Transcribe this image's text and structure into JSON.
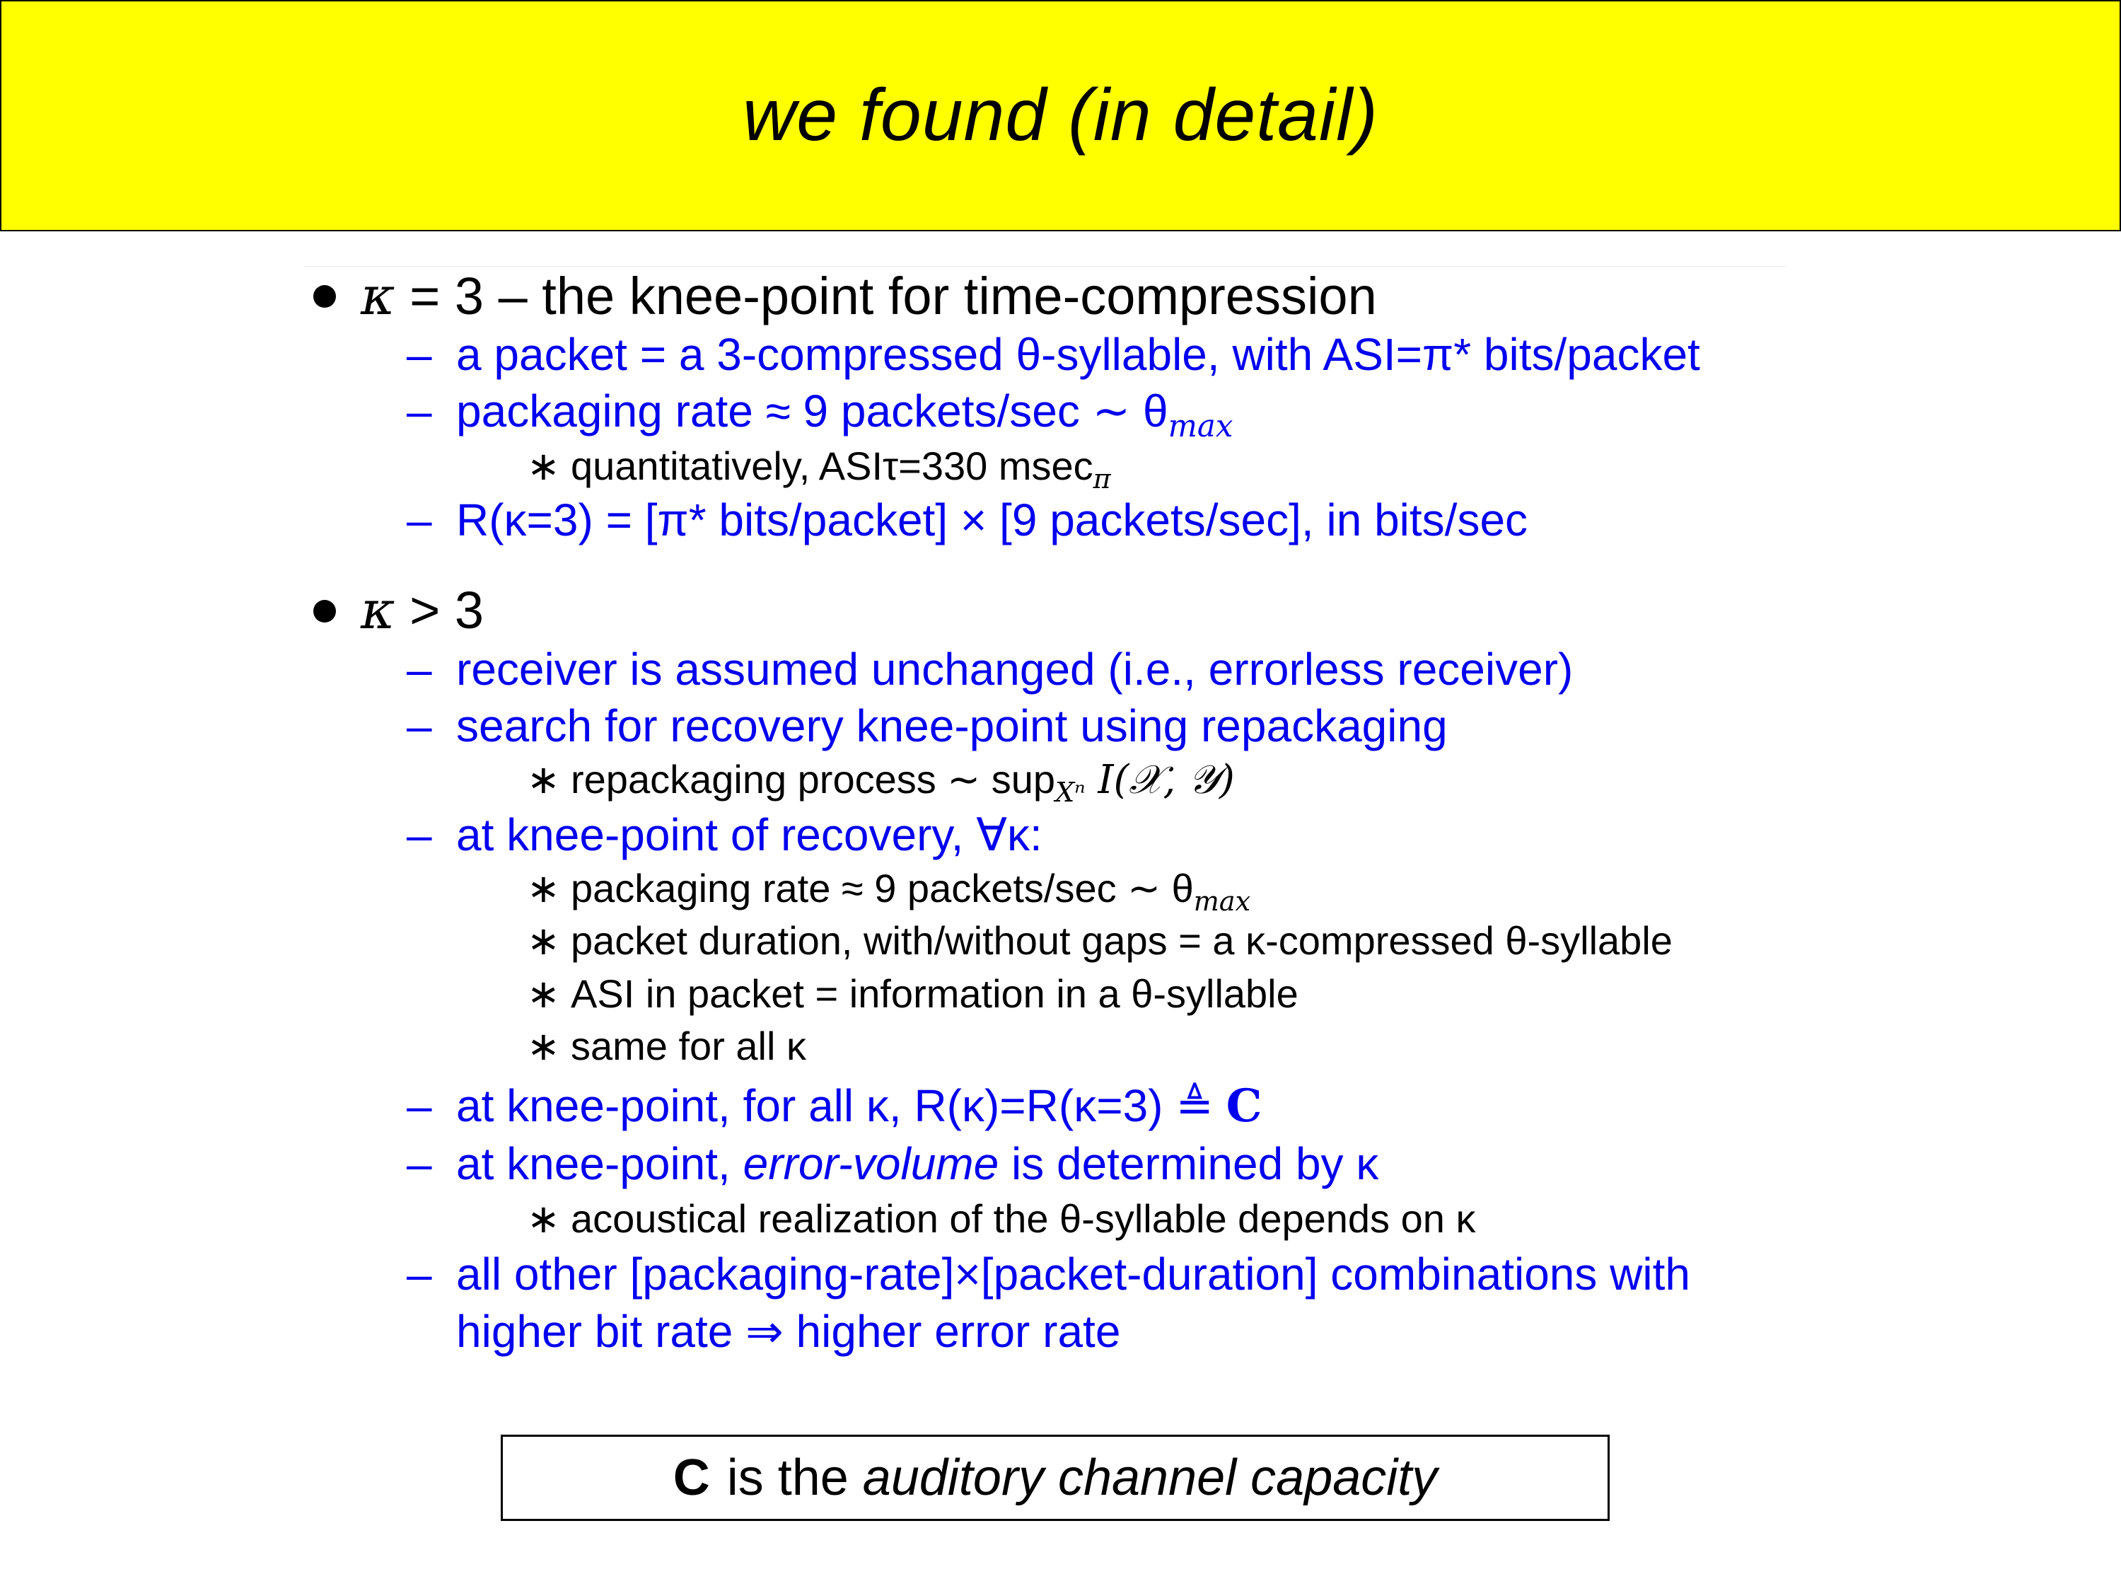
{
  "title": "we found (in detail)",
  "section1": {
    "heading_kappa": "κ",
    "heading_eq": " = 3 – the knee-point for time-compression",
    "items": [
      "a packet = a 3-compressed θ-syllable, with ASI=π* bits/packet",
      "packaging rate ≈ 9 packets/sec ∼ θ",
      "quantitatively, ASIτ=330 msec",
      "R(κ=3) = [π* bits/packet] × [9 packets/sec], in bits/sec"
    ],
    "sub_max": "max",
    "sub_pi": "π"
  },
  "section2": {
    "heading_kappa": "κ",
    "heading_rest": " > 3",
    "items": [
      "receiver is assumed unchanged (i.e., errorless receiver)",
      "search for recovery knee-point using repackaging",
      "repackaging process ∼ sup",
      "at knee-point of recovery,  ∀κ:",
      "packaging rate ≈ 9 packets/sec ∼ θ",
      "packet duration, with/without gaps = a κ-compressed θ-syllable",
      "ASI in packet = information in a θ-syllable",
      "same for all κ",
      "at knee-point, for all κ, R(κ)=R(κ=3) ≜ ",
      "C",
      "at knee-point, ",
      "error-volume",
      " is determined by κ",
      "acoustical realization of the θ-syllable depends on κ",
      "all other [packaging-rate]×[packet-duration] combinations with",
      "higher bit rate ⇒ higher error rate"
    ],
    "sup_sub": "Xⁿ",
    "sup_rest": " I(𝒳, 𝒴)",
    "sub_max": "max"
  },
  "footer": {
    "bold": "C",
    "plain": "is the",
    "italic": "auditory channel capacity"
  }
}
